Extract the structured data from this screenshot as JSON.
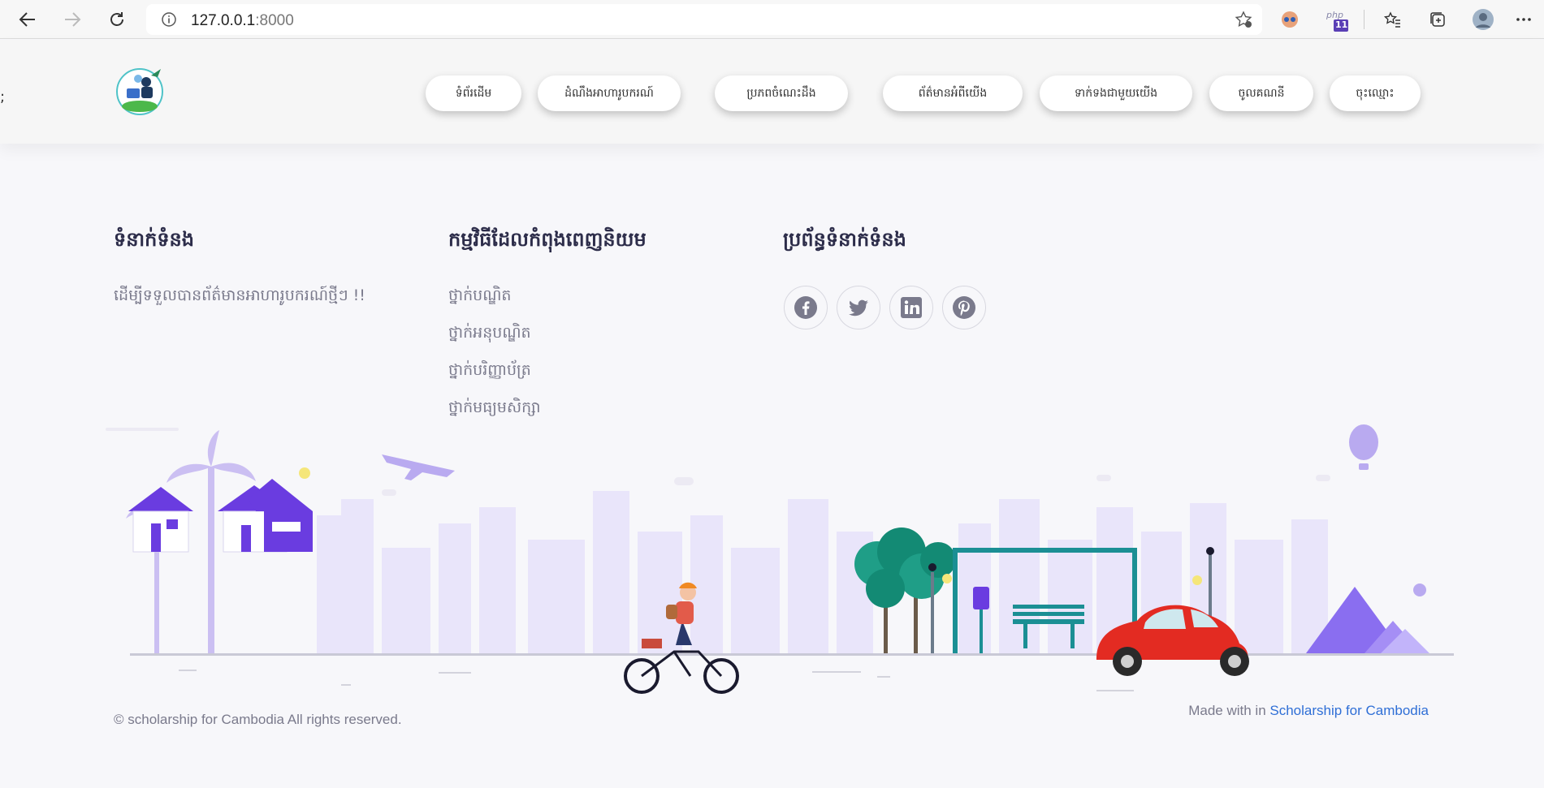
{
  "browser": {
    "url_host": "127.0.0.1",
    "url_port": ":8000",
    "php_badge": "11"
  },
  "header": {
    "stray_char": ";",
    "nav": [
      "ទំព័រដើម",
      "ដំណឹងអាហារូបករណ៍",
      "ប្រភពចំណេះដឹង",
      "ព័ត៌មានអំពីយើង",
      "ទាក់ទងជាមួយយើង",
      "ចូលគណនី",
      "ចុះឈ្មោះ"
    ]
  },
  "footer": {
    "contact": {
      "title": "ទំនាក់ទំនង",
      "text": "ដើម្បីទទួលបានព័ត៌មានអាហារូបករណ៍ថ្មីៗ !!"
    },
    "programs": {
      "title": "កម្មវិធីដែលកំពុងពេញនិយម",
      "items": [
        "ថ្នាក់បណ្ឌិត",
        "ថ្នាក់អនុបណ្ឌិត",
        "ថ្នាក់បរិញ្ញាប័ត្រ",
        "ថ្នាក់មធ្យមសិក្សា"
      ]
    },
    "social": {
      "title": "ប្រព័ន្ធទំនាក់ទំនង",
      "icons": [
        "facebook-icon",
        "twitter-icon",
        "linkedin-icon",
        "pinterest-icon"
      ]
    },
    "copyright": "© scholarship for Cambodia All rights reserved.",
    "made_with_prefix": "Made with in",
    "made_with_link": "Scholarship for Cambodia"
  },
  "colors": {
    "accent": "#2f6fd6",
    "heading": "#2d2d4a",
    "city": "#e6e1f8",
    "house": "#6a3ce0"
  }
}
